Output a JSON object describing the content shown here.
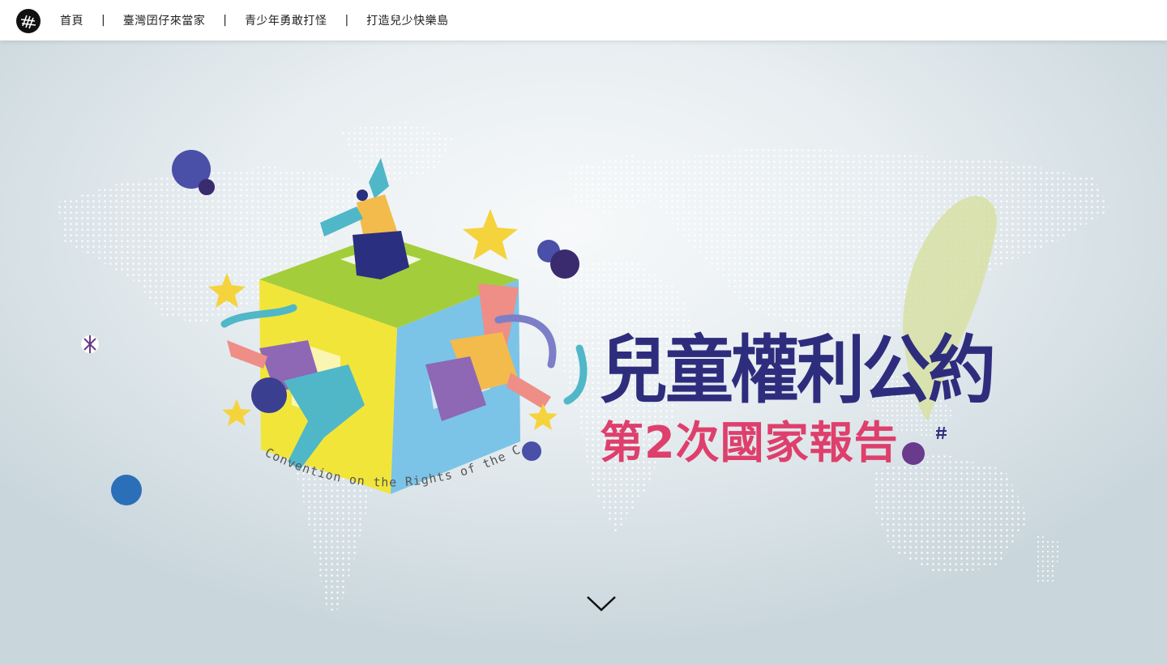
{
  "nav": {
    "items": [
      {
        "label": "首頁"
      },
      {
        "label": "臺灣囝仔來當家"
      },
      {
        "label": "青少年勇敢打怪"
      },
      {
        "label": "打造兒少快樂島"
      }
    ],
    "separator": "|"
  },
  "hero": {
    "title": "兒童權利公約",
    "subtitle": "第2次國家報告",
    "tagline": "Convention on the Rights of the Child"
  },
  "colors": {
    "title": "#2e2d7d",
    "subtitle": "#de3f6c",
    "cube_top": "#a4cd3b",
    "cube_left": "#f2e53a",
    "cube_right": "#7cc3e8",
    "star": "#f5d33d",
    "taiwan": "#d7e0a4"
  },
  "icons": [
    "logo-icon",
    "chevron-down-icon"
  ]
}
